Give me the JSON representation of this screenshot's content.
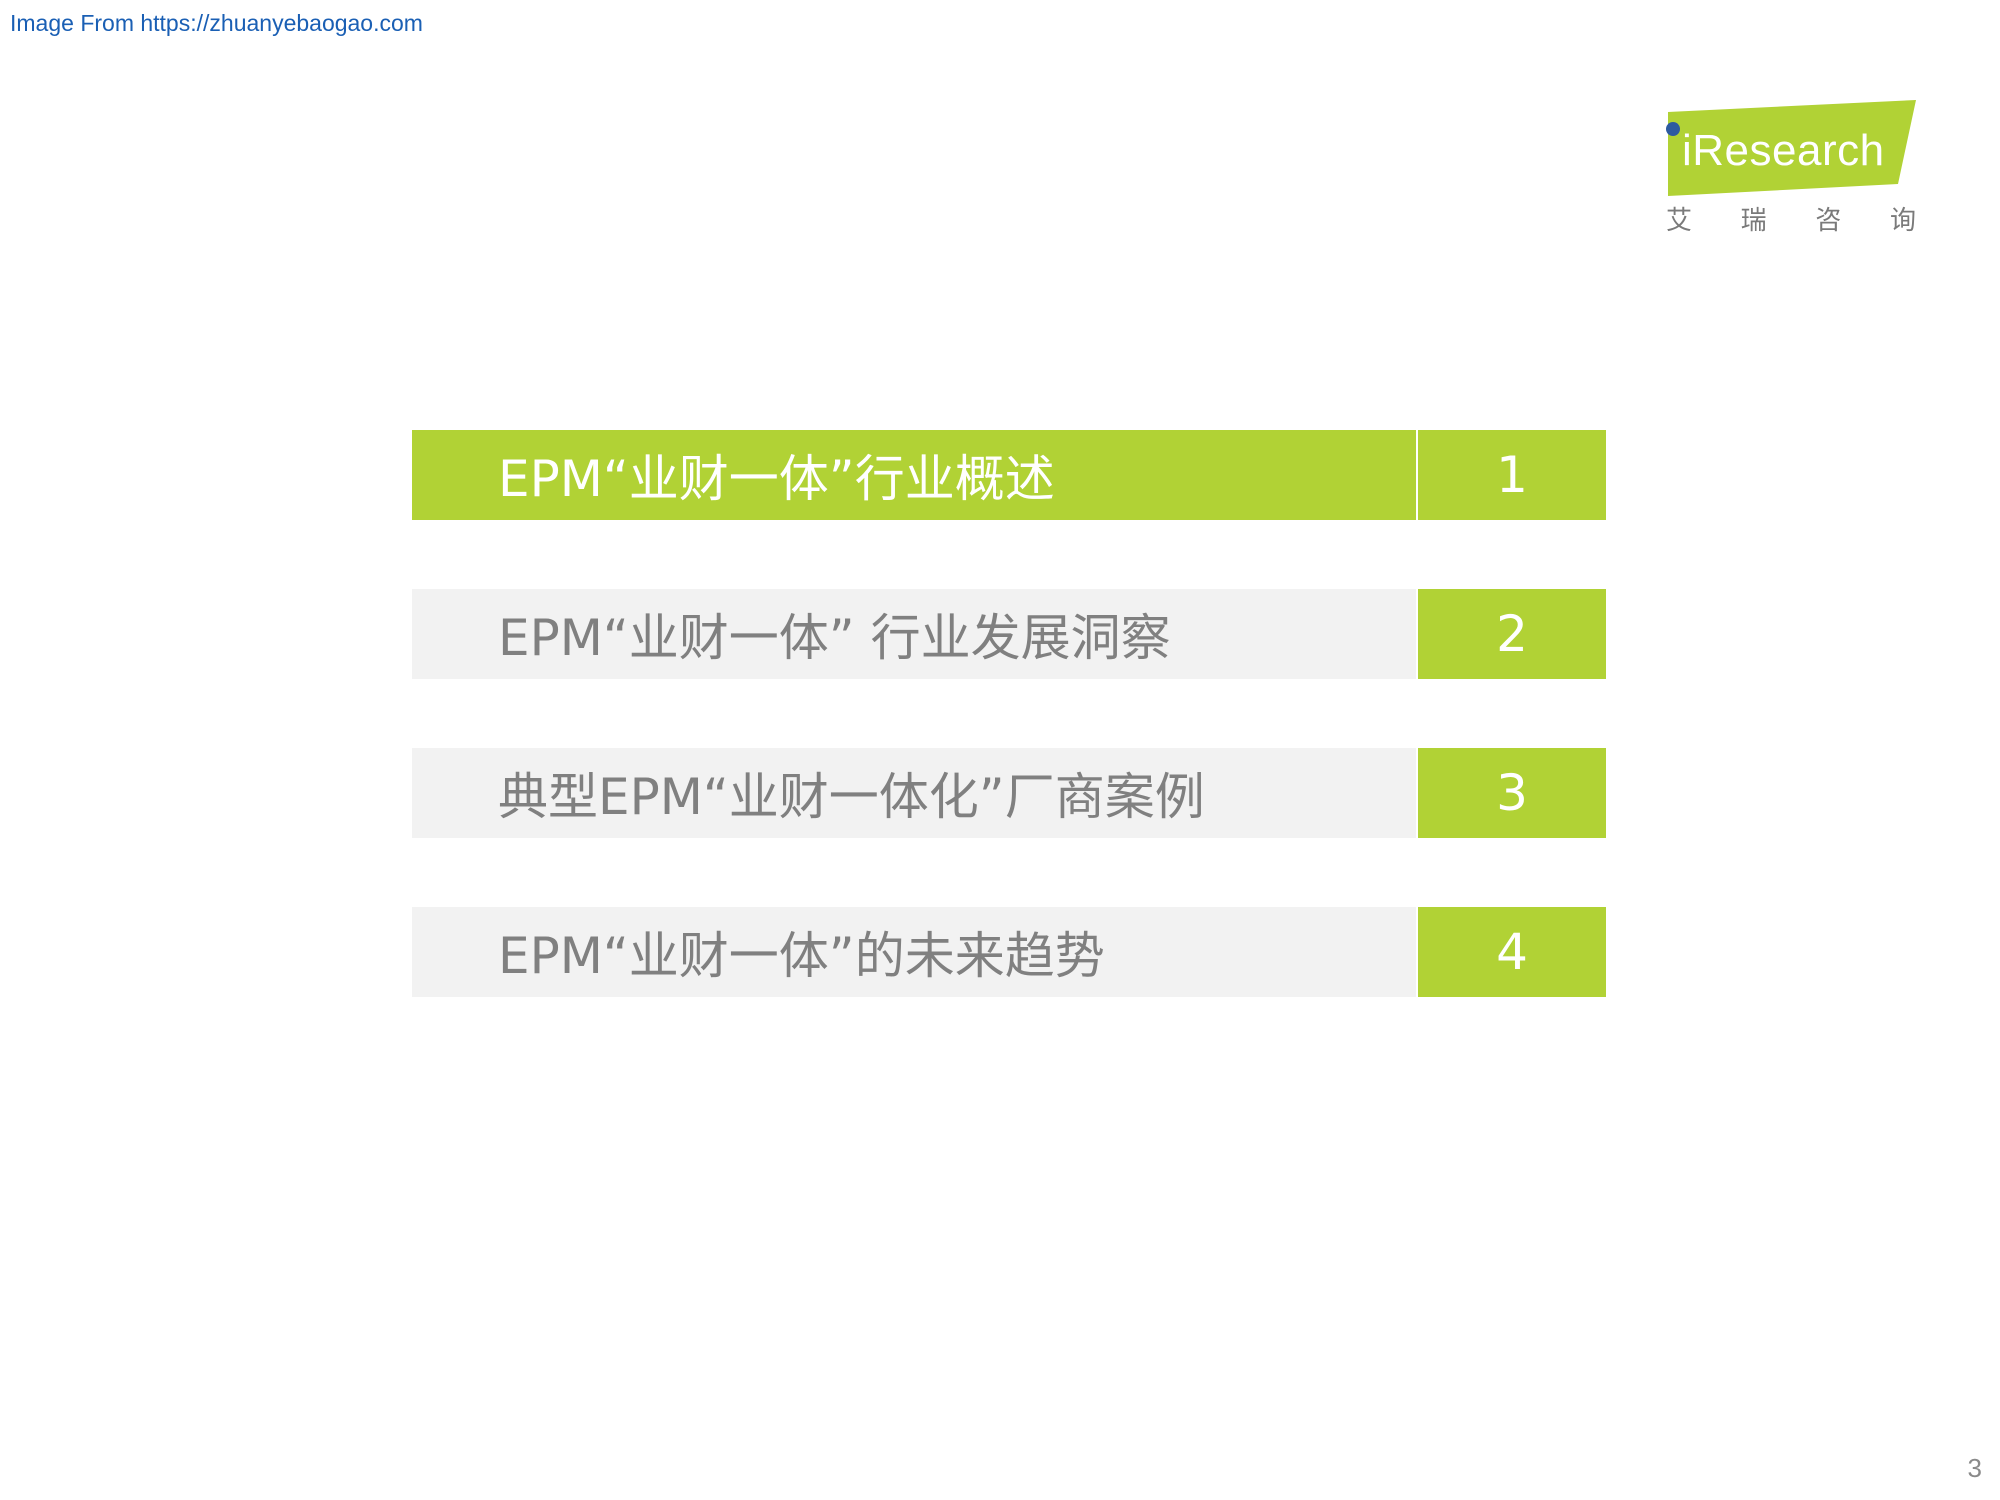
{
  "source": {
    "text": "Image From https://zhuanyebaogao.com"
  },
  "logo": {
    "brand_text": "Research",
    "cn_chars": [
      "艾",
      "瑞",
      "咨",
      "询"
    ],
    "brand_color": "#b1d235",
    "dot_color": "#2d5aa0"
  },
  "toc": {
    "items": [
      {
        "label": "EPM“业财一体”行业概述",
        "number": "1",
        "active": true
      },
      {
        "label": "EPM“业财一体” 行业发展洞察",
        "number": "2",
        "active": false
      },
      {
        "label": "典型EPM“业财一体化”厂商案例",
        "number": "3",
        "active": false
      },
      {
        "label": "EPM“业财一体”的未来趋势",
        "number": "4",
        "active": false
      }
    ],
    "accent_color": "#b1d235",
    "inactive_bg": "#f2f2f2",
    "inactive_text_color": "#808080"
  },
  "page": {
    "number": "3"
  }
}
